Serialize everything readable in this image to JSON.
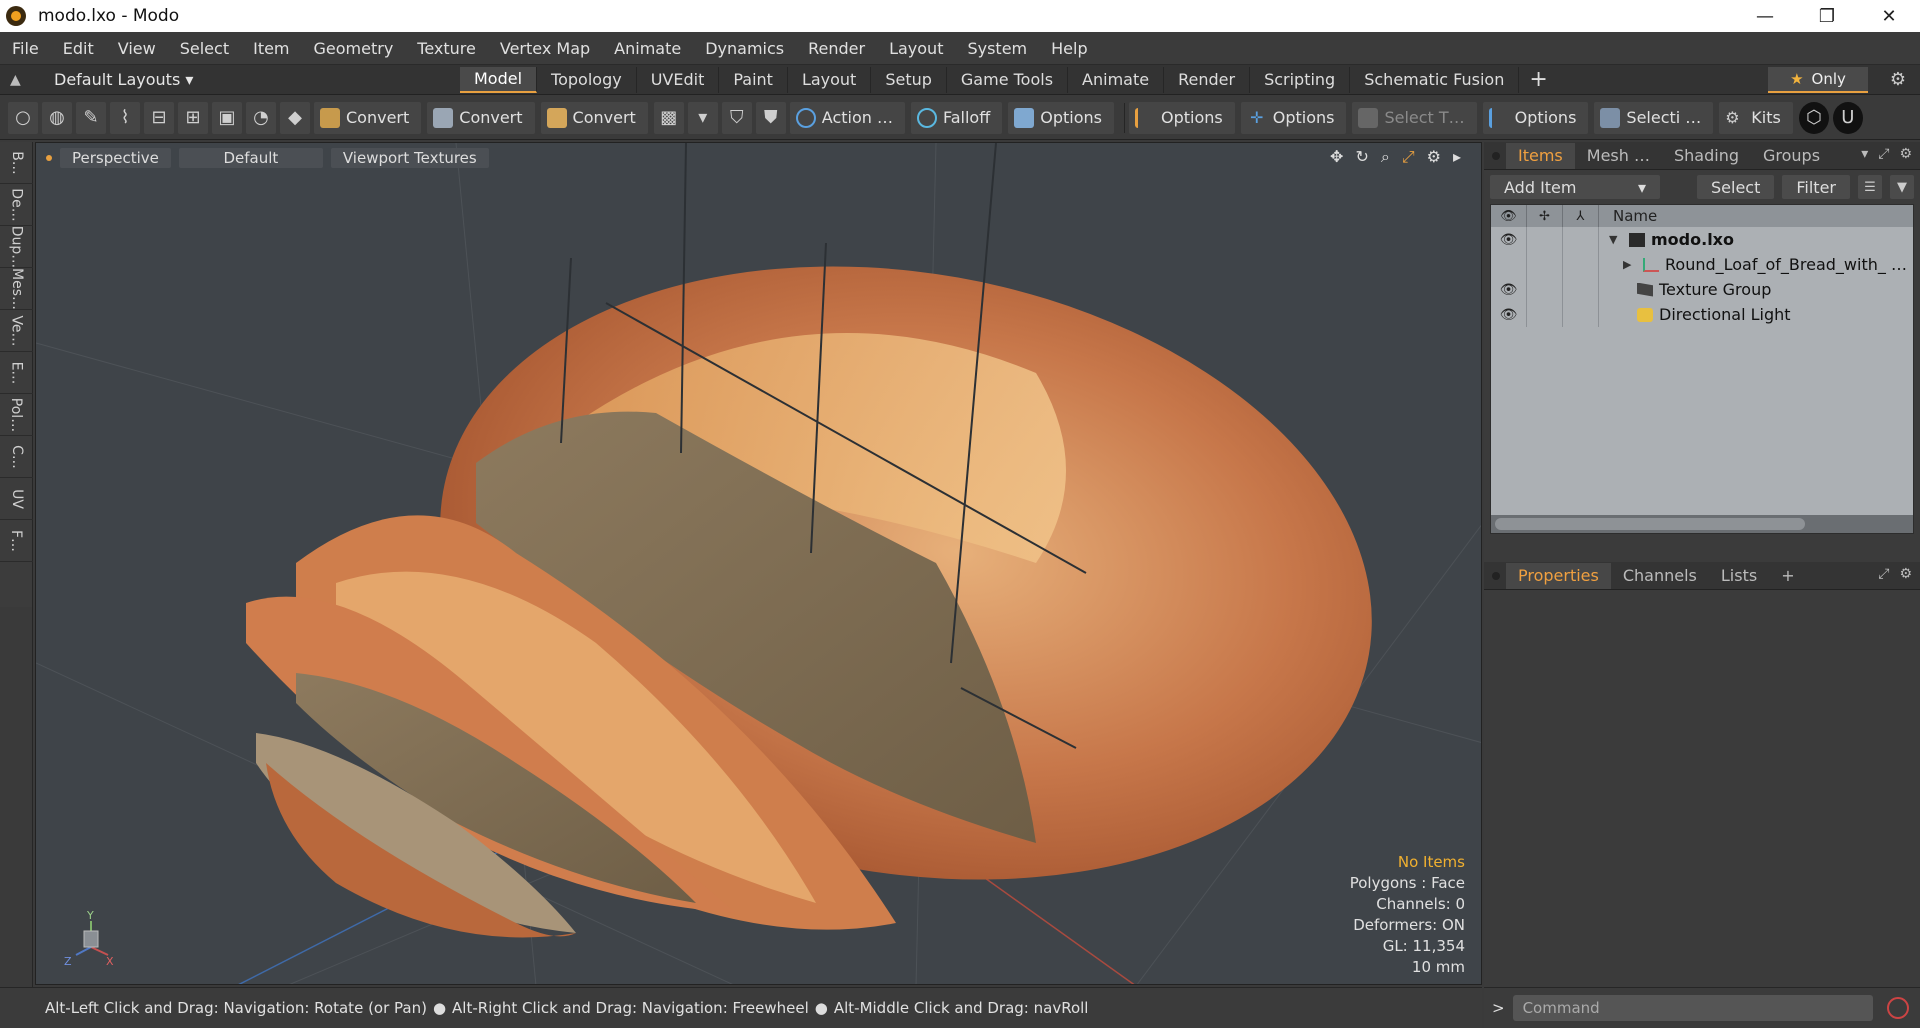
{
  "window": {
    "title": "modo.lxo - Modo",
    "minimize": "—",
    "maximize": "❐",
    "close": "✕"
  },
  "menu": [
    "File",
    "Edit",
    "View",
    "Select",
    "Item",
    "Geometry",
    "Texture",
    "Vertex Map",
    "Animate",
    "Dynamics",
    "Render",
    "Layout",
    "System",
    "Help"
  ],
  "layout": {
    "selector": "Default Layouts ▾",
    "tabs": [
      "Model",
      "Topology",
      "UVEdit",
      "Paint",
      "Layout",
      "Setup",
      "Game Tools",
      "Animate",
      "Render",
      "Scripting",
      "Schematic Fusion"
    ],
    "active_tab": "Model",
    "plus": "+",
    "only_label": "Only"
  },
  "toolbar": {
    "convert1": "Convert",
    "convert2": "Convert",
    "convert3": "Convert",
    "action": "Action …",
    "falloff": "Falloff",
    "options1": "Options",
    "options2": "Options",
    "options3": "Options",
    "select_t": "Select T…",
    "options4": "Options",
    "selecti": "Selecti …",
    "kits": "Kits"
  },
  "left_tabs": [
    "B…",
    "De…",
    "Dup…",
    "Mes…",
    "Ve…",
    "E…",
    "Pol…",
    "C…",
    "UV",
    "F…"
  ],
  "viewport": {
    "perspective": "Perspective",
    "default": "Default",
    "textures": "Viewport Textures",
    "info": {
      "no_items": "No Items",
      "polygons": "Polygons : Face",
      "channels": "Channels: 0",
      "deformers": "Deformers: ON",
      "gl": "GL: 11,354",
      "scale": "10 mm"
    },
    "axis": {
      "y": "Y",
      "x": "X",
      "z": "Z"
    }
  },
  "items_panel": {
    "tabs": [
      "Items",
      "Mesh …",
      "Shading",
      "Groups"
    ],
    "active_tab": "Items",
    "add_item": "Add Item",
    "select": "Select",
    "filter": "Filter",
    "name_header": "Name",
    "rows": [
      {
        "label": "modo.lxo",
        "bold": true
      },
      {
        "label": "Round_Loaf_of_Bread_with_ …",
        "bold": false
      },
      {
        "label": "Texture Group",
        "bold": false
      },
      {
        "label": "Directional Light",
        "bold": false
      }
    ]
  },
  "properties_panel": {
    "tabs": [
      "Properties",
      "Channels",
      "Lists"
    ],
    "active_tab": "Properties",
    "plus": "+"
  },
  "status": {
    "hint1": "Alt-Left Click and Drag: Navigation: Rotate (or Pan)",
    "hint2": "Alt-Right Click and Drag: Navigation: Freewheel",
    "hint3": "Alt-Middle Click and Drag: navRoll"
  },
  "command": {
    "placeholder": "Command",
    "prompt": ">"
  }
}
